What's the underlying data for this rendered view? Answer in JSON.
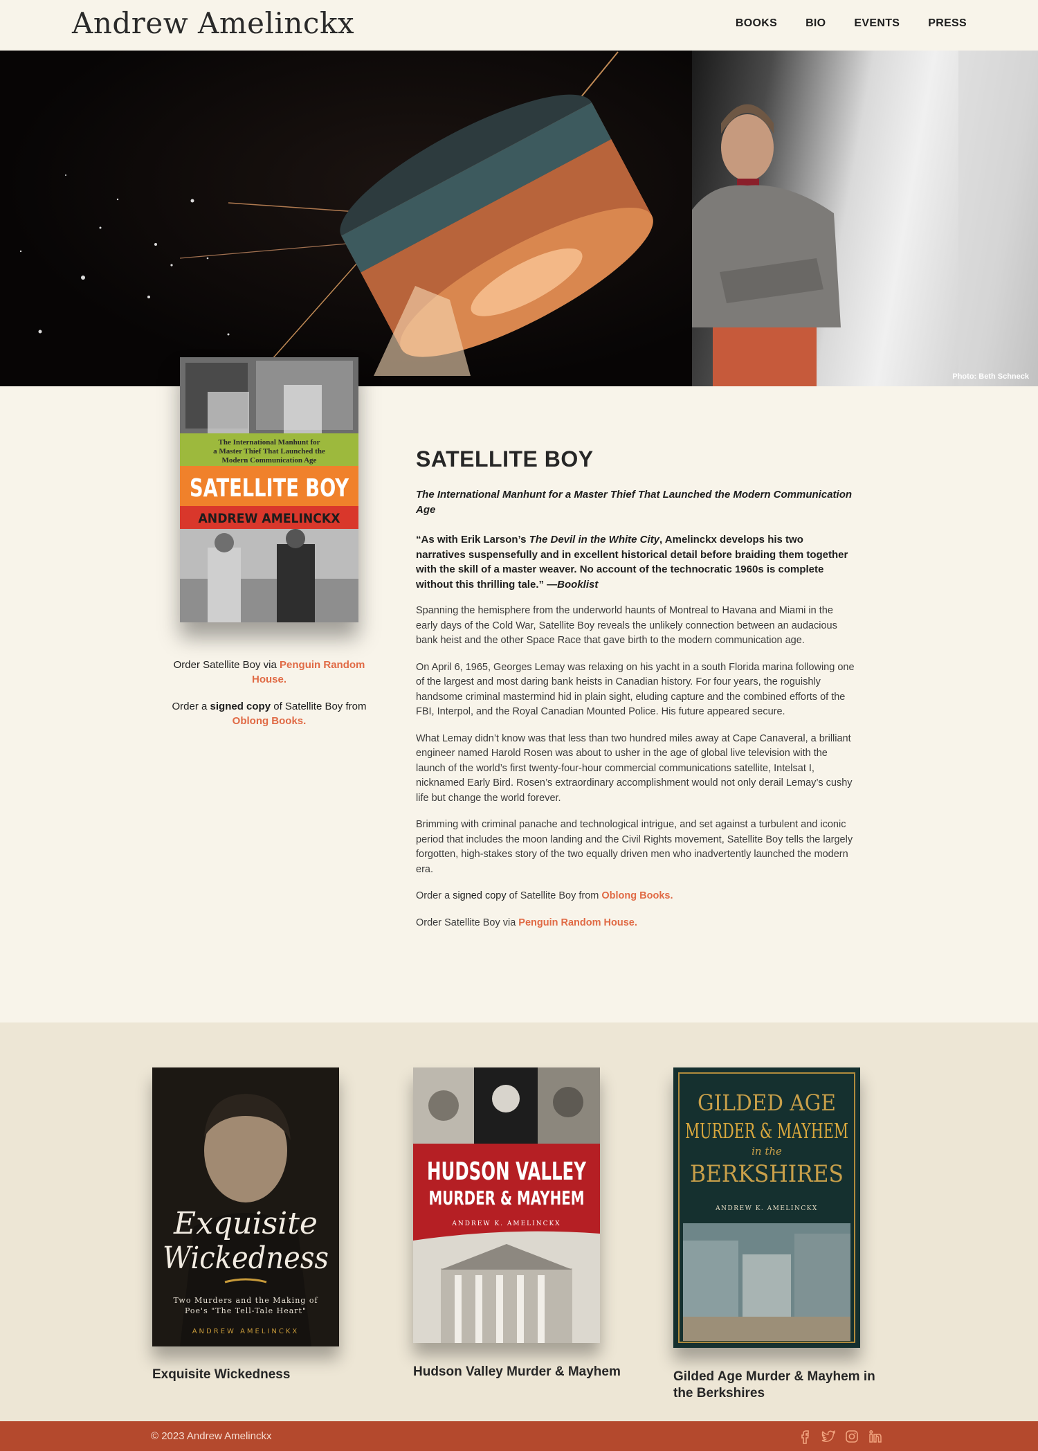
{
  "header": {
    "site_title": "Andrew Amelinckx",
    "nav": [
      "BOOKS",
      "BIO",
      "EVENTS",
      "PRESS"
    ]
  },
  "hero": {
    "photo_credit": "Photo: Beth Schneck"
  },
  "featured_book": {
    "cover": {
      "tagline_line1": "The International Manhunt for",
      "tagline_line2": "a Master Thief That Launched the",
      "tagline_line3": "Modern Communication Age",
      "title": "SATELLITE BOY",
      "author": "ANDREW AMELINCKX"
    },
    "order": {
      "via_prefix": "Order Satellite Boy via ",
      "via_link": "Penguin Random House.",
      "signed_prefix": "Order a ",
      "signed_strong": "signed copy",
      "signed_mid": " of Satellite Boy from ",
      "signed_link": "Oblong Books."
    },
    "title": "SATELLITE BOY",
    "subtitle": "The International Manhunt for a Master Thief That Launched the Modern Communication Age",
    "quote_part1": "“As with Erik Larson’s ",
    "quote_italic": "The Devil in the White City",
    "quote_part2": ", Amelinckx develops his two narratives suspensefully and in excellent historical detail before braiding them together with the skill of a master weaver. No account of the technocratic 1960s is complete without this thrilling tale.” —",
    "quote_source": "Booklist",
    "paragraphs": [
      "Spanning the hemisphere from the underworld haunts of Montreal to Havana and Miami in the early days of the Cold War, Satellite Boy reveals the unlikely connection between an audacious bank heist and the other Space Race that gave birth to the modern communication age.",
      "On April 6, 1965, Georges Lemay was relaxing on his yacht in a south Florida marina following one of the largest and most daring bank heists in Canadian history. For four years, the roguishly handsome criminal mastermind hid in plain sight, eluding capture and the combined efforts of the FBI, Interpol, and the Royal Canadian Mounted Police. His future appeared secure.",
      "What Lemay didn’t know was that less than two hundred miles away at Cape Canaveral, a brilliant engineer named Harold Rosen was about to usher in the age of global live television with the launch of the world’s first twenty-four-hour commercial communications satellite, Intelsat I, nicknamed Early Bird. Rosen’s extraordinary accomplishment would not only derail Lemay’s cushy life but change the world forever.",
      "Brimming with criminal panache and technological intrigue, and set against a turbulent and iconic period that includes the moon landing and the Civil Rights movement, Satellite Boy tells the largely forgotten, high-stakes story of the two equally driven men who inadvertently launched the modern era."
    ],
    "order_bottom": {
      "signed_prefix": "Order a ",
      "signed_strong": "signed copy",
      "signed_mid": " of Satellite Boy from ",
      "signed_link": "Oblong Books.",
      "via_prefix": "Order Satellite Boy via ",
      "via_link": "Penguin Random House."
    }
  },
  "other_books": [
    {
      "name": "Exquisite Wickedness",
      "cover_title_1": "Exquisite",
      "cover_title_2": "Wickedness",
      "cover_sub_1": "Two Murders and the Making of",
      "cover_sub_2": "Poe's \"The Tell-Tale Heart\"",
      "cover_author": "ANDREW AMELINCKX"
    },
    {
      "name": "Hudson Valley Murder & Mayhem",
      "cover_title_1": "HUDSON VALLEY",
      "cover_title_2": "MURDER & MAYHEM",
      "cover_author": "ANDREW K. AMELINCKX"
    },
    {
      "name": "Gilded Age Murder & Mayhem in the Berkshires",
      "cover_title_1": "GILDED AGE",
      "cover_title_2": "MURDER & MAYHEM",
      "cover_title_3": "in the",
      "cover_title_4": "BERKSHIRES",
      "cover_author": "ANDREW K. AMELINCKX"
    }
  ],
  "footer": {
    "copyright": "© 2023 Andrew Amelinckx",
    "social_icons": [
      "facebook-icon",
      "twitter-icon",
      "instagram-icon",
      "linkedin-icon"
    ]
  },
  "colors": {
    "background": "#f8f4ea",
    "band": "#ede6d5",
    "accent_link": "#e06a45",
    "footer": "#b4492d"
  }
}
